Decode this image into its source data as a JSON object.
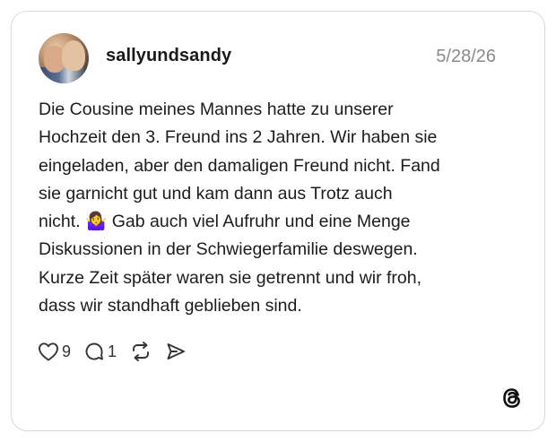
{
  "post": {
    "username": "sallyundsandy",
    "date": "5/28/26",
    "text": "Die Cousine meines Mannes hatte zu unserer\nHochzeit den 3. Freund ins 2 Jahren. Wir haben sie\neingeladen, aber den damaligen Freund nicht. Fand\nsie garnicht gut und kam dann aus Trotz auch\nnicht. 🤷‍♀️ Gab auch viel Aufruhr und eine Menge\nDiskussionen in der Schwiegerfamilie deswegen.\nKurze Zeit später waren sie getrennt und wir froh,\ndass wir standhaft geblieben sind."
  },
  "actions": {
    "likes": "9",
    "replies": "1",
    "icons": [
      "heart-icon",
      "comment-icon",
      "repost-icon",
      "share-icon"
    ]
  },
  "brand": {
    "icon": "threads-logo-icon"
  },
  "colors": {
    "border": "#d9d9d9",
    "text": "#1c1c1c",
    "muted": "#8a8a8a"
  }
}
